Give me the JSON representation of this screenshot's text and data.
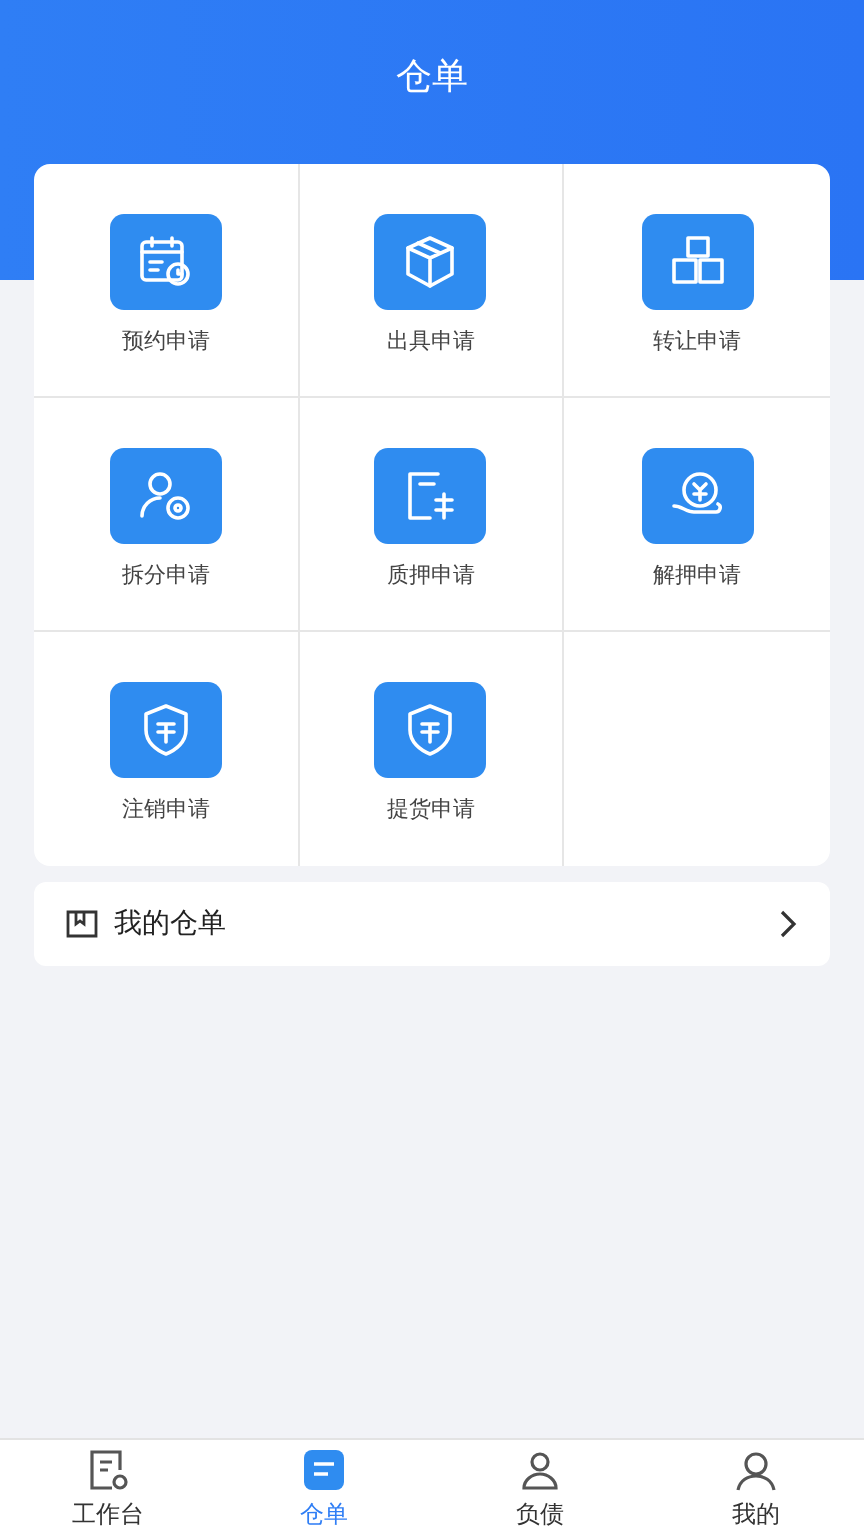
{
  "header": {
    "title": "仓单"
  },
  "grid": {
    "items": [
      {
        "label": "预约申请",
        "kind": "calendar"
      },
      {
        "label": "出具申请",
        "kind": "box"
      },
      {
        "label": "转让申请",
        "kind": "boxes"
      },
      {
        "label": "拆分申请",
        "kind": "usergear"
      },
      {
        "label": "质押申请",
        "kind": "doc"
      },
      {
        "label": "解押申请",
        "kind": "coin"
      },
      {
        "label": "注销申请",
        "kind": "shield"
      },
      {
        "label": "提货申请",
        "kind": "shield"
      }
    ]
  },
  "my_receipts": {
    "label": "我的仓单"
  },
  "tab_bar": [
    {
      "label": "工作台",
      "kind": "desk",
      "selected": false
    },
    {
      "label": "仓单",
      "kind": "doc",
      "selected": true
    },
    {
      "label": "负债",
      "kind": "user",
      "selected": false
    },
    {
      "label": "我的",
      "kind": "person",
      "selected": false
    }
  ]
}
